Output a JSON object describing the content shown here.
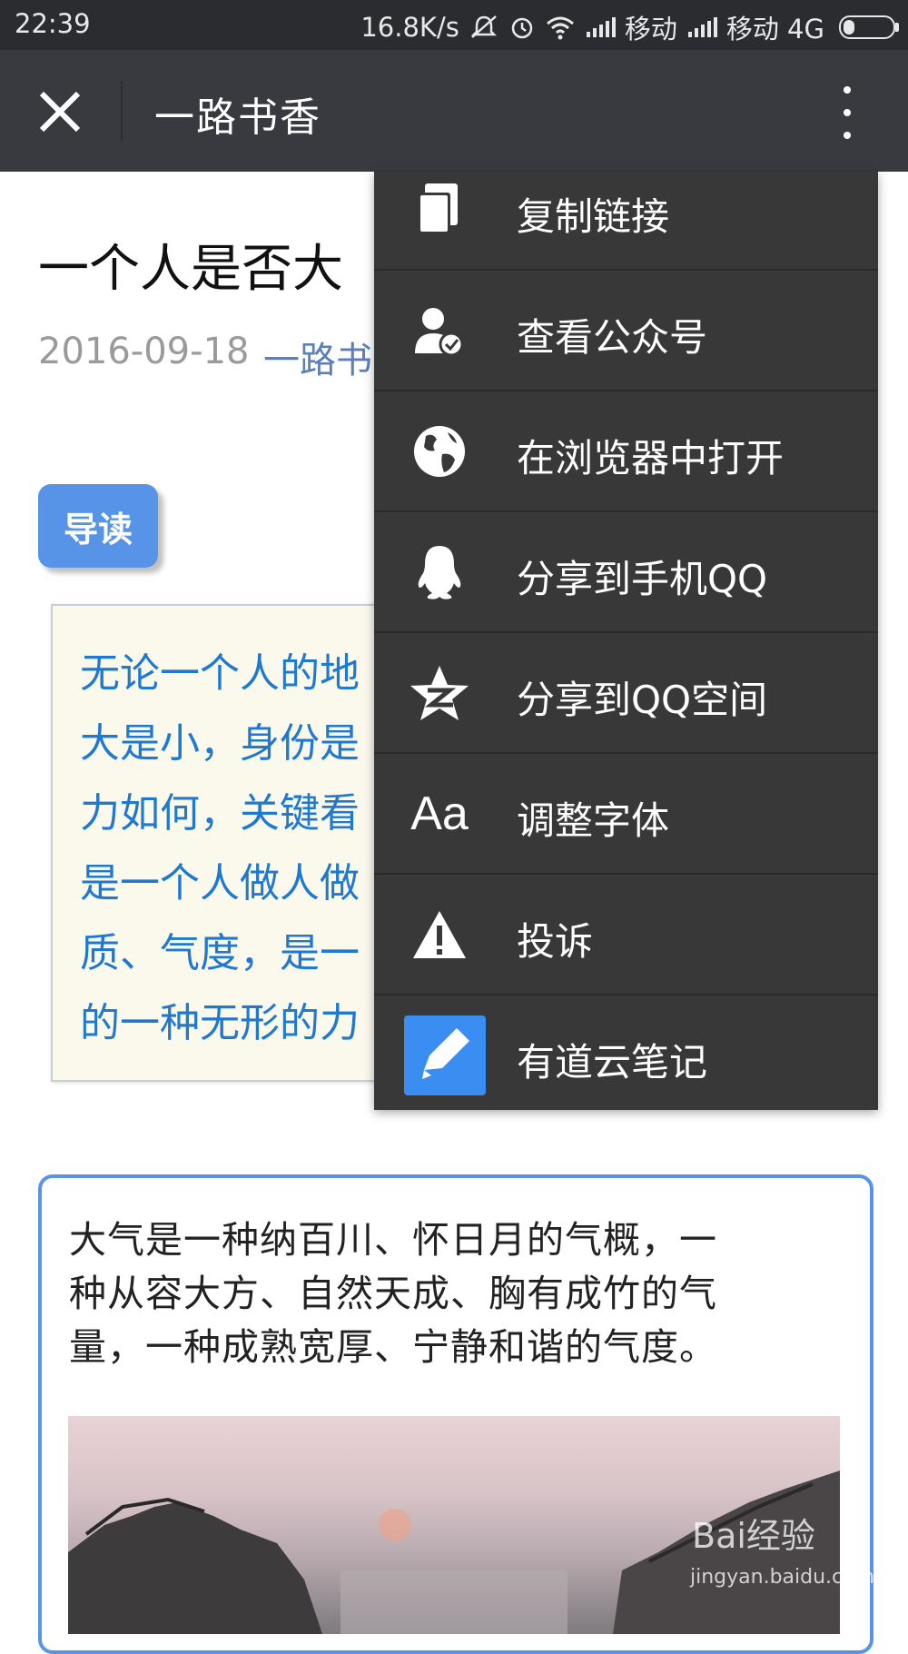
{
  "status_bar": {
    "time": "22:39",
    "speed": "16.8K/s",
    "carrier1": "移动",
    "carrier2": "移动 4G"
  },
  "title_bar": {
    "title": "一路书香"
  },
  "article": {
    "title": "一个人是否大",
    "date": "2016-09-18",
    "author": "一路书",
    "guide_label": "导读",
    "guide_lines": [
      "无论一个人的地",
      "大是小，身份是",
      "力如何，关键看",
      "是一个人做人做",
      "质、气度，是一",
      "的一种无形的力"
    ],
    "quote_lines": [
      "大气是一种纳百川、怀日月的气概，一",
      "种从容大方、自然天成、胸有成竹的气",
      "量，一种成熟宽厚、宁静和谐的气度。"
    ]
  },
  "menu": {
    "items": [
      {
        "label": "复制链接",
        "icon": "copy-icon"
      },
      {
        "label": "查看公众号",
        "icon": "official-account-icon"
      },
      {
        "label": "在浏览器中打开",
        "icon": "globe-icon"
      },
      {
        "label": "分享到手机QQ",
        "icon": "qq-penguin-icon"
      },
      {
        "label": "分享到QQ空间",
        "icon": "qzone-star-icon"
      },
      {
        "label": "调整字体",
        "icon": "font-icon",
        "glyph": "Aa"
      },
      {
        "label": "投诉",
        "icon": "warning-icon"
      },
      {
        "label": "有道云笔记",
        "icon": "youdao-note-icon"
      }
    ]
  },
  "watermark": {
    "brand": "Bai经验",
    "site": "jingyan.baidu.com"
  },
  "colors": {
    "status_bg": "#2b2c30",
    "title_bg": "#393a3f",
    "menu_bg": "#383838",
    "accent_blue": "#5794e8",
    "guide_text": "#1f78d1"
  }
}
